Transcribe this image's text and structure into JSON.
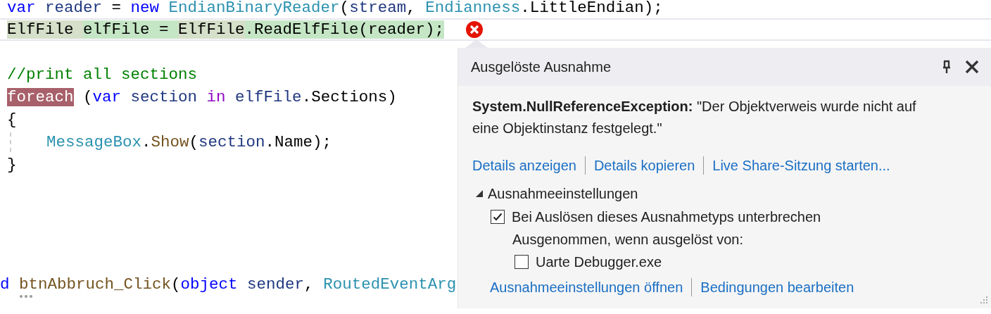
{
  "code_lines": [
    {
      "kind": "code",
      "current": false,
      "indent": false,
      "tokens": [
        {
          "kind": "keyword",
          "text": "var"
        },
        {
          "kind": "variable",
          "text": " reader"
        },
        {
          "kind": "plain",
          "text": " = "
        },
        {
          "kind": "keyword",
          "text": "new"
        },
        {
          "kind": "type",
          "text": " EndianBinaryReader"
        },
        {
          "kind": "plain",
          "text": "("
        },
        {
          "kind": "variable",
          "text": "stream"
        },
        {
          "kind": "plain",
          "text": ", "
        },
        {
          "kind": "type",
          "text": "Endianness"
        },
        {
          "kind": "plain",
          "text": ".LittleEndian);"
        }
      ]
    },
    {
      "kind": "code",
      "current": true,
      "indent": false,
      "tokens": [
        {
          "kind": "type-plain",
          "text": "ElfFile "
        },
        {
          "kind": "plain",
          "text": "elfFile = "
        },
        {
          "kind": "type-plain",
          "text": "ElfFile"
        },
        {
          "kind": "plain",
          "text": ".ReadElfFile(reader);"
        }
      ]
    },
    {
      "kind": "blank"
    },
    {
      "kind": "code",
      "current": false,
      "indent": false,
      "tokens": [
        {
          "kind": "comment",
          "text": "//print all sections"
        }
      ]
    },
    {
      "kind": "code",
      "current": false,
      "indent": false,
      "tokens": [
        {
          "kind": "keyword",
          "text": "foreach",
          "highlighted": true
        },
        {
          "kind": "plain",
          "text": " ("
        },
        {
          "kind": "keyword",
          "text": "var"
        },
        {
          "kind": "variable",
          "text": " section "
        },
        {
          "kind": "control",
          "text": "in"
        },
        {
          "kind": "variable",
          "text": " elfFile"
        },
        {
          "kind": "plain",
          "text": ".Sections)"
        }
      ]
    },
    {
      "kind": "code",
      "current": false,
      "indent": false,
      "tokens": [
        {
          "kind": "plain",
          "text": "{"
        }
      ]
    },
    {
      "kind": "code",
      "current": false,
      "indent": true,
      "tokens": [
        {
          "kind": "type",
          "text": "MessageBox"
        },
        {
          "kind": "plain",
          "text": "."
        },
        {
          "kind": "method",
          "text": "Show"
        },
        {
          "kind": "plain",
          "text": "("
        },
        {
          "kind": "variable",
          "text": "section"
        },
        {
          "kind": "plain",
          "text": ".Name);"
        }
      ]
    },
    {
      "kind": "code",
      "current": false,
      "indent": false,
      "tokens": [
        {
          "kind": "plain",
          "text": "}"
        }
      ]
    }
  ],
  "bottom_line": {
    "tokens": [
      {
        "kind": "keyword",
        "text": "d"
      },
      {
        "kind": "method",
        "text": " btnAbbruch_Click"
      },
      {
        "kind": "plain",
        "text": "("
      },
      {
        "kind": "keyword",
        "text": "object"
      },
      {
        "kind": "variable",
        "text": " sender"
      },
      {
        "kind": "plain",
        "text": ", "
      },
      {
        "kind": "type",
        "text": "RoutedEventArg"
      }
    ]
  },
  "exception_popup": {
    "title": "Ausgelöste Ausnahme",
    "message": "**System.NullReferenceException:** \"Der Objektverweis wurde nicht auf eine Objektinstanz festgelegt.\"",
    "links": [
      "Details anzeigen",
      "Details kopieren",
      "Live Share-Sitzung starten..."
    ],
    "settings": {
      "label": "Ausnahmeeinstellungen",
      "expanded": true,
      "options": [
        {
          "label": "Bei Auslösen dieses Ausnahmetyps unterbrechen",
          "checked": true
        }
      ],
      "except_label": "Ausgenommen, wenn ausgelöst von:",
      "except_options": [
        {
          "label": "Uarte Debugger.exe",
          "checked": false
        }
      ]
    },
    "footer_links": [
      "Ausnahmeeinstellungen öffnen",
      "Bedingungen bearbeiten"
    ]
  }
}
